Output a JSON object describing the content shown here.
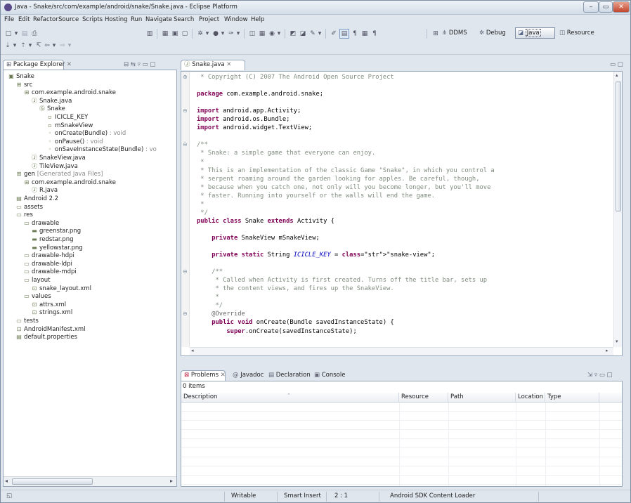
{
  "window": {
    "title": "Java - Snake/src/com/example/android/snake/Snake.java - Eclipse Platform",
    "minimize": "–",
    "maximize": "▭",
    "close": "✕"
  },
  "menu": [
    "File",
    "Edit",
    "Refactor",
    "Source",
    "Scripts",
    "Hosting",
    "Run",
    "Navigate",
    "Search",
    "Project",
    "Window",
    "Help"
  ],
  "perspectives": {
    "ddms": "DDMS",
    "debug": "Debug",
    "java": "Java",
    "resource": "Resource"
  },
  "explorer": {
    "tab_label": "Package Explorer",
    "tree": [
      {
        "label": "Snake",
        "icon": "project-icon"
      },
      {
        "label": "src",
        "icon": "source-folder-icon"
      },
      {
        "label": "com.example.android.snake",
        "icon": "package-icon"
      },
      {
        "label": "Snake.java",
        "icon": "java-file-icon"
      },
      {
        "label": "Snake",
        "icon": "class-icon"
      },
      {
        "label": "ICICLE_KEY",
        "icon": "field-icon"
      },
      {
        "label": "mSnakeView",
        "icon": "field-icon"
      },
      {
        "label": "onCreate(Bundle)",
        "suffix": " : void",
        "icon": "method-icon"
      },
      {
        "label": "onPause()",
        "suffix": " : void",
        "icon": "method-icon"
      },
      {
        "label": "onSaveInstanceState(Bundle)",
        "suffix": " : vo",
        "icon": "method-icon"
      },
      {
        "label": "SnakeView.java",
        "icon": "java-file-icon"
      },
      {
        "label": "TileView.java",
        "icon": "java-file-icon"
      },
      {
        "label": "gen",
        "suffix": " [Generated Java Files]",
        "icon": "source-folder-icon"
      },
      {
        "label": "com.example.android.snake",
        "icon": "package-icon"
      },
      {
        "label": "R.java",
        "icon": "java-file-icon"
      },
      {
        "label": "Android 2.2",
        "icon": "library-icon"
      },
      {
        "label": "assets",
        "icon": "folder-icon"
      },
      {
        "label": "res",
        "icon": "folder-icon"
      },
      {
        "label": "drawable",
        "icon": "folder-icon"
      },
      {
        "label": "greenstar.png",
        "icon": "image-file-icon"
      },
      {
        "label": "redstar.png",
        "icon": "image-file-icon"
      },
      {
        "label": "yellowstar.png",
        "icon": "image-file-icon"
      },
      {
        "label": "drawable-hdpi",
        "icon": "folder-icon"
      },
      {
        "label": "drawable-ldpi",
        "icon": "folder-icon"
      },
      {
        "label": "drawable-mdpi",
        "icon": "folder-icon"
      },
      {
        "label": "layout",
        "icon": "folder-icon"
      },
      {
        "label": "snake_layout.xml",
        "icon": "xml-file-icon"
      },
      {
        "label": "values",
        "icon": "folder-icon"
      },
      {
        "label": "attrs.xml",
        "icon": "xml-file-icon"
      },
      {
        "label": "strings.xml",
        "icon": "xml-file-icon"
      },
      {
        "label": "tests",
        "icon": "folder-icon"
      },
      {
        "label": "AndroidManifest.xml",
        "icon": "xml-file-icon"
      },
      {
        "label": "default.properties",
        "icon": "text-file-icon"
      }
    ]
  },
  "editor": {
    "tab_label": "Snake.java",
    "lines": [
      {
        "t": " * Copyright (C) 2007 The Android Open Source Project",
        "c": "cm"
      },
      {
        "t": "",
        "c": ""
      },
      {
        "t": "package com.example.android.snake;",
        "c": ""
      },
      {
        "t": "",
        "c": ""
      },
      {
        "t": "import android.app.Activity;",
        "c": ""
      },
      {
        "t": "import android.os.Bundle;",
        "c": ""
      },
      {
        "t": "import android.widget.TextView;",
        "c": ""
      },
      {
        "t": "",
        "c": ""
      },
      {
        "t": "/**",
        "c": "cm"
      },
      {
        "t": " * Snake: a simple game that everyone can enjoy.",
        "c": "cm"
      },
      {
        "t": " *",
        "c": "cm"
      },
      {
        "t": " * This is an implementation of the classic Game \"Snake\", in which you control a",
        "c": "cm"
      },
      {
        "t": " * serpent roaming around the garden looking for apples. Be careful, though,",
        "c": "cm"
      },
      {
        "t": " * because when you catch one, not only will you become longer, but you'll move",
        "c": "cm"
      },
      {
        "t": " * faster. Running into yourself or the walls will end the game.",
        "c": "cm"
      },
      {
        "t": " *",
        "c": "cm"
      },
      {
        "t": " */",
        "c": "cm"
      },
      {
        "t": "public class Snake extends Activity {",
        "c": ""
      },
      {
        "t": "",
        "c": ""
      },
      {
        "t": "    private SnakeView mSnakeView;",
        "c": ""
      },
      {
        "t": "",
        "c": ""
      },
      {
        "t": "    private static String ICICLE_KEY = \"snake-view\";",
        "c": ""
      },
      {
        "t": "",
        "c": ""
      },
      {
        "t": "    /**",
        "c": "cm"
      },
      {
        "t": "     * Called when Activity is first created. Turns off the title bar, sets up",
        "c": "cm"
      },
      {
        "t": "     * the content views, and fires up the SnakeView.",
        "c": "cm"
      },
      {
        "t": "     *",
        "c": "cm"
      },
      {
        "t": "     */",
        "c": "cm"
      },
      {
        "t": "    @Override",
        "c": "ann"
      },
      {
        "t": "    public void onCreate(Bundle savedInstanceState) {",
        "c": ""
      },
      {
        "t": "        super.onCreate(savedInstanceState);",
        "c": ""
      }
    ]
  },
  "problems": {
    "tabs": [
      "Problems",
      "Javadoc",
      "Declaration",
      "Console"
    ],
    "count": "0 items",
    "columns": [
      "Description",
      "Resource",
      "Path",
      "Location",
      "Type"
    ]
  },
  "status": {
    "writable": "Writable",
    "insert_mode": "Smart Insert",
    "position": "2 : 1",
    "task": "Android SDK Content Loader"
  },
  "colors": {
    "chrome": "#dfe6ee",
    "panel_border": "#99a8ba",
    "comment": "#7f8c7f",
    "keyword": "#7f0055",
    "string": "#2a00ff"
  }
}
